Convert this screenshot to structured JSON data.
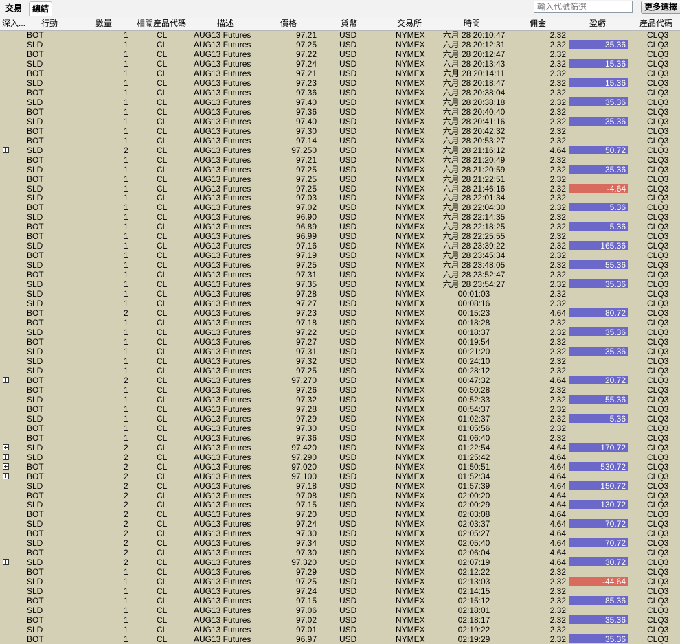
{
  "tabs": {
    "trade": "交易",
    "summary": "總結"
  },
  "filter": {
    "placeholder": "輸入代號篩選"
  },
  "more_button": "更多選擇",
  "columns": [
    "深入...",
    "行動",
    "數量",
    "相關產品代碼",
    "描述",
    "價格",
    "貨幣",
    "交易所",
    "時間",
    "佣金",
    "盈虧",
    "產品代碼"
  ],
  "colors": {
    "profit": "#6b68c9",
    "loss": "#d96b5e",
    "background": "#d4d0b5"
  },
  "rows": [
    {
      "e": 0,
      "a": "BOT",
      "q": "1",
      "u": "CL",
      "d": "AUG13 Futures",
      "p": "97.21",
      "cur": "USD",
      "x": "NYMEX",
      "t": "六月 28 20:10:47",
      "f": "2.32",
      "l": "",
      "k": "",
      "s": "CLQ3"
    },
    {
      "e": 0,
      "a": "SLD",
      "q": "1",
      "u": "CL",
      "d": "AUG13 Futures",
      "p": "97.25",
      "cur": "USD",
      "x": "NYMEX",
      "t": "六月 28 20:12:31",
      "f": "2.32",
      "l": "35.36",
      "k": "pos",
      "s": "CLQ3"
    },
    {
      "e": 0,
      "a": "BOT",
      "q": "1",
      "u": "CL",
      "d": "AUG13 Futures",
      "p": "97.22",
      "cur": "USD",
      "x": "NYMEX",
      "t": "六月 28 20:12:47",
      "f": "2.32",
      "l": "",
      "k": "",
      "s": "CLQ3"
    },
    {
      "e": 0,
      "a": "SLD",
      "q": "1",
      "u": "CL",
      "d": "AUG13 Futures",
      "p": "97.24",
      "cur": "USD",
      "x": "NYMEX",
      "t": "六月 28 20:13:43",
      "f": "2.32",
      "l": "15.36",
      "k": "pos",
      "s": "CLQ3"
    },
    {
      "e": 0,
      "a": "BOT",
      "q": "1",
      "u": "CL",
      "d": "AUG13 Futures",
      "p": "97.21",
      "cur": "USD",
      "x": "NYMEX",
      "t": "六月 28 20:14:11",
      "f": "2.32",
      "l": "",
      "k": "",
      "s": "CLQ3"
    },
    {
      "e": 0,
      "a": "SLD",
      "q": "1",
      "u": "CL",
      "d": "AUG13 Futures",
      "p": "97.23",
      "cur": "USD",
      "x": "NYMEX",
      "t": "六月 28 20:18:47",
      "f": "2.32",
      "l": "15.36",
      "k": "pos",
      "s": "CLQ3"
    },
    {
      "e": 0,
      "a": "BOT",
      "q": "1",
      "u": "CL",
      "d": "AUG13 Futures",
      "p": "97.36",
      "cur": "USD",
      "x": "NYMEX",
      "t": "六月 28 20:38:04",
      "f": "2.32",
      "l": "",
      "k": "",
      "s": "CLQ3"
    },
    {
      "e": 0,
      "a": "SLD",
      "q": "1",
      "u": "CL",
      "d": "AUG13 Futures",
      "p": "97.40",
      "cur": "USD",
      "x": "NYMEX",
      "t": "六月 28 20:38:18",
      "f": "2.32",
      "l": "35.36",
      "k": "pos",
      "s": "CLQ3"
    },
    {
      "e": 0,
      "a": "BOT",
      "q": "1",
      "u": "CL",
      "d": "AUG13 Futures",
      "p": "97.36",
      "cur": "USD",
      "x": "NYMEX",
      "t": "六月 28 20:40:40",
      "f": "2.32",
      "l": "",
      "k": "",
      "s": "CLQ3"
    },
    {
      "e": 0,
      "a": "SLD",
      "q": "1",
      "u": "CL",
      "d": "AUG13 Futures",
      "p": "97.40",
      "cur": "USD",
      "x": "NYMEX",
      "t": "六月 28 20:41:16",
      "f": "2.32",
      "l": "35.36",
      "k": "pos",
      "s": "CLQ3"
    },
    {
      "e": 0,
      "a": "BOT",
      "q": "1",
      "u": "CL",
      "d": "AUG13 Futures",
      "p": "97.30",
      "cur": "USD",
      "x": "NYMEX",
      "t": "六月 28 20:42:32",
      "f": "2.32",
      "l": "",
      "k": "",
      "s": "CLQ3"
    },
    {
      "e": 0,
      "a": "BOT",
      "q": "1",
      "u": "CL",
      "d": "AUG13 Futures",
      "p": "97.14",
      "cur": "USD",
      "x": "NYMEX",
      "t": "六月 28 20:53:27",
      "f": "2.32",
      "l": "",
      "k": "",
      "s": "CLQ3"
    },
    {
      "e": 1,
      "a": "SLD",
      "q": "2",
      "u": "CL",
      "d": "AUG13 Futures",
      "p": "97.250",
      "cur": "USD",
      "x": "NYMEX",
      "t": "六月 28 21:16:12",
      "f": "4.64",
      "l": "50.72",
      "k": "pos",
      "s": "CLQ3"
    },
    {
      "e": 0,
      "a": "BOT",
      "q": "1",
      "u": "CL",
      "d": "AUG13 Futures",
      "p": "97.21",
      "cur": "USD",
      "x": "NYMEX",
      "t": "六月 28 21:20:49",
      "f": "2.32",
      "l": "",
      "k": "",
      "s": "CLQ3"
    },
    {
      "e": 0,
      "a": "SLD",
      "q": "1",
      "u": "CL",
      "d": "AUG13 Futures",
      "p": "97.25",
      "cur": "USD",
      "x": "NYMEX",
      "t": "六月 28 21:20:59",
      "f": "2.32",
      "l": "35.36",
      "k": "pos",
      "s": "CLQ3"
    },
    {
      "e": 0,
      "a": "BOT",
      "q": "1",
      "u": "CL",
      "d": "AUG13 Futures",
      "p": "97.25",
      "cur": "USD",
      "x": "NYMEX",
      "t": "六月 28 21:22:51",
      "f": "2.32",
      "l": "",
      "k": "",
      "s": "CLQ3"
    },
    {
      "e": 0,
      "a": "SLD",
      "q": "1",
      "u": "CL",
      "d": "AUG13 Futures",
      "p": "97.25",
      "cur": "USD",
      "x": "NYMEX",
      "t": "六月 28 21:46:16",
      "f": "2.32",
      "l": "-4.64",
      "k": "neg",
      "s": "CLQ3"
    },
    {
      "e": 0,
      "a": "SLD",
      "q": "1",
      "u": "CL",
      "d": "AUG13 Futures",
      "p": "97.03",
      "cur": "USD",
      "x": "NYMEX",
      "t": "六月 28 22:01:34",
      "f": "2.32",
      "l": "",
      "k": "",
      "s": "CLQ3"
    },
    {
      "e": 0,
      "a": "BOT",
      "q": "1",
      "u": "CL",
      "d": "AUG13 Futures",
      "p": "97.02",
      "cur": "USD",
      "x": "NYMEX",
      "t": "六月 28 22:04:30",
      "f": "2.32",
      "l": "5.36",
      "k": "pos",
      "s": "CLQ3"
    },
    {
      "e": 0,
      "a": "SLD",
      "q": "1",
      "u": "CL",
      "d": "AUG13 Futures",
      "p": "96.90",
      "cur": "USD",
      "x": "NYMEX",
      "t": "六月 28 22:14:35",
      "f": "2.32",
      "l": "",
      "k": "",
      "s": "CLQ3"
    },
    {
      "e": 0,
      "a": "BOT",
      "q": "1",
      "u": "CL",
      "d": "AUG13 Futures",
      "p": "96.89",
      "cur": "USD",
      "x": "NYMEX",
      "t": "六月 28 22:18:25",
      "f": "2.32",
      "l": "5.36",
      "k": "pos",
      "s": "CLQ3"
    },
    {
      "e": 0,
      "a": "BOT",
      "q": "1",
      "u": "CL",
      "d": "AUG13 Futures",
      "p": "96.99",
      "cur": "USD",
      "x": "NYMEX",
      "t": "六月 28 22:25:55",
      "f": "2.32",
      "l": "",
      "k": "",
      "s": "CLQ3"
    },
    {
      "e": 0,
      "a": "SLD",
      "q": "1",
      "u": "CL",
      "d": "AUG13 Futures",
      "p": "97.16",
      "cur": "USD",
      "x": "NYMEX",
      "t": "六月 28 23:39:22",
      "f": "2.32",
      "l": "165.36",
      "k": "pos",
      "s": "CLQ3"
    },
    {
      "e": 0,
      "a": "BOT",
      "q": "1",
      "u": "CL",
      "d": "AUG13 Futures",
      "p": "97.19",
      "cur": "USD",
      "x": "NYMEX",
      "t": "六月 28 23:45:34",
      "f": "2.32",
      "l": "",
      "k": "",
      "s": "CLQ3"
    },
    {
      "e": 0,
      "a": "SLD",
      "q": "1",
      "u": "CL",
      "d": "AUG13 Futures",
      "p": "97.25",
      "cur": "USD",
      "x": "NYMEX",
      "t": "六月 28 23:48:05",
      "f": "2.32",
      "l": "55.36",
      "k": "pos",
      "s": "CLQ3"
    },
    {
      "e": 0,
      "a": "BOT",
      "q": "1",
      "u": "CL",
      "d": "AUG13 Futures",
      "p": "97.31",
      "cur": "USD",
      "x": "NYMEX",
      "t": "六月 28 23:52:47",
      "f": "2.32",
      "l": "",
      "k": "",
      "s": "CLQ3"
    },
    {
      "e": 0,
      "a": "SLD",
      "q": "1",
      "u": "CL",
      "d": "AUG13 Futures",
      "p": "97.35",
      "cur": "USD",
      "x": "NYMEX",
      "t": "六月 28 23:54:27",
      "f": "2.32",
      "l": "35.36",
      "k": "pos",
      "s": "CLQ3"
    },
    {
      "e": 0,
      "a": "SLD",
      "q": "1",
      "u": "CL",
      "d": "AUG13 Futures",
      "p": "97.28",
      "cur": "USD",
      "x": "NYMEX",
      "t": "00:01:03",
      "f": "2.32",
      "l": "",
      "k": "",
      "s": "CLQ3"
    },
    {
      "e": 0,
      "a": "SLD",
      "q": "1",
      "u": "CL",
      "d": "AUG13 Futures",
      "p": "97.27",
      "cur": "USD",
      "x": "NYMEX",
      "t": "00:08:16",
      "f": "2.32",
      "l": "",
      "k": "",
      "s": "CLQ3"
    },
    {
      "e": 0,
      "a": "BOT",
      "q": "2",
      "u": "CL",
      "d": "AUG13 Futures",
      "p": "97.23",
      "cur": "USD",
      "x": "NYMEX",
      "t": "00:15:23",
      "f": "4.64",
      "l": "80.72",
      "k": "pos",
      "s": "CLQ3"
    },
    {
      "e": 0,
      "a": "BOT",
      "q": "1",
      "u": "CL",
      "d": "AUG13 Futures",
      "p": "97.18",
      "cur": "USD",
      "x": "NYMEX",
      "t": "00:18:28",
      "f": "2.32",
      "l": "",
      "k": "",
      "s": "CLQ3"
    },
    {
      "e": 0,
      "a": "SLD",
      "q": "1",
      "u": "CL",
      "d": "AUG13 Futures",
      "p": "97.22",
      "cur": "USD",
      "x": "NYMEX",
      "t": "00:18:37",
      "f": "2.32",
      "l": "35.36",
      "k": "pos",
      "s": "CLQ3"
    },
    {
      "e": 0,
      "a": "BOT",
      "q": "1",
      "u": "CL",
      "d": "AUG13 Futures",
      "p": "97.27",
      "cur": "USD",
      "x": "NYMEX",
      "t": "00:19:54",
      "f": "2.32",
      "l": "",
      "k": "",
      "s": "CLQ3"
    },
    {
      "e": 0,
      "a": "SLD",
      "q": "1",
      "u": "CL",
      "d": "AUG13 Futures",
      "p": "97.31",
      "cur": "USD",
      "x": "NYMEX",
      "t": "00:21:20",
      "f": "2.32",
      "l": "35.36",
      "k": "pos",
      "s": "CLQ3"
    },
    {
      "e": 0,
      "a": "SLD",
      "q": "1",
      "u": "CL",
      "d": "AUG13 Futures",
      "p": "97.32",
      "cur": "USD",
      "x": "NYMEX",
      "t": "00:24:10",
      "f": "2.32",
      "l": "",
      "k": "",
      "s": "CLQ3"
    },
    {
      "e": 0,
      "a": "SLD",
      "q": "1",
      "u": "CL",
      "d": "AUG13 Futures",
      "p": "97.25",
      "cur": "USD",
      "x": "NYMEX",
      "t": "00:28:12",
      "f": "2.32",
      "l": "",
      "k": "",
      "s": "CLQ3"
    },
    {
      "e": 1,
      "a": "BOT",
      "q": "2",
      "u": "CL",
      "d": "AUG13 Futures",
      "p": "97.270",
      "cur": "USD",
      "x": "NYMEX",
      "t": "00:47:32",
      "f": "4.64",
      "l": "20.72",
      "k": "pos",
      "s": "CLQ3"
    },
    {
      "e": 0,
      "a": "BOT",
      "q": "1",
      "u": "CL",
      "d": "AUG13 Futures",
      "p": "97.26",
      "cur": "USD",
      "x": "NYMEX",
      "t": "00:50:28",
      "f": "2.32",
      "l": "",
      "k": "",
      "s": "CLQ3"
    },
    {
      "e": 0,
      "a": "SLD",
      "q": "1",
      "u": "CL",
      "d": "AUG13 Futures",
      "p": "97.32",
      "cur": "USD",
      "x": "NYMEX",
      "t": "00:52:33",
      "f": "2.32",
      "l": "55.36",
      "k": "pos",
      "s": "CLQ3"
    },
    {
      "e": 0,
      "a": "BOT",
      "q": "1",
      "u": "CL",
      "d": "AUG13 Futures",
      "p": "97.28",
      "cur": "USD",
      "x": "NYMEX",
      "t": "00:54:37",
      "f": "2.32",
      "l": "",
      "k": "",
      "s": "CLQ3"
    },
    {
      "e": 0,
      "a": "SLD",
      "q": "1",
      "u": "CL",
      "d": "AUG13 Futures",
      "p": "97.29",
      "cur": "USD",
      "x": "NYMEX",
      "t": "01:02:37",
      "f": "2.32",
      "l": "5.36",
      "k": "pos",
      "s": "CLQ3"
    },
    {
      "e": 0,
      "a": "BOT",
      "q": "1",
      "u": "CL",
      "d": "AUG13 Futures",
      "p": "97.30",
      "cur": "USD",
      "x": "NYMEX",
      "t": "01:05:56",
      "f": "2.32",
      "l": "",
      "k": "",
      "s": "CLQ3"
    },
    {
      "e": 0,
      "a": "BOT",
      "q": "1",
      "u": "CL",
      "d": "AUG13 Futures",
      "p": "97.36",
      "cur": "USD",
      "x": "NYMEX",
      "t": "01:06:40",
      "f": "2.32",
      "l": "",
      "k": "",
      "s": "CLQ3"
    },
    {
      "e": 1,
      "a": "SLD",
      "q": "2",
      "u": "CL",
      "d": "AUG13 Futures",
      "p": "97.420",
      "cur": "USD",
      "x": "NYMEX",
      "t": "01:22:54",
      "f": "4.64",
      "l": "170.72",
      "k": "pos",
      "s": "CLQ3"
    },
    {
      "e": 1,
      "a": "SLD",
      "q": "2",
      "u": "CL",
      "d": "AUG13 Futures",
      "p": "97.290",
      "cur": "USD",
      "x": "NYMEX",
      "t": "01:25:42",
      "f": "4.64",
      "l": "",
      "k": "",
      "s": "CLQ3"
    },
    {
      "e": 1,
      "a": "BOT",
      "q": "2",
      "u": "CL",
      "d": "AUG13 Futures",
      "p": "97.020",
      "cur": "USD",
      "x": "NYMEX",
      "t": "01:50:51",
      "f": "4.64",
      "l": "530.72",
      "k": "pos",
      "s": "CLQ3"
    },
    {
      "e": 1,
      "a": "BOT",
      "q": "2",
      "u": "CL",
      "d": "AUG13 Futures",
      "p": "97.100",
      "cur": "USD",
      "x": "NYMEX",
      "t": "01:52:34",
      "f": "4.64",
      "l": "",
      "k": "",
      "s": "CLQ3"
    },
    {
      "e": 0,
      "a": "SLD",
      "q": "2",
      "u": "CL",
      "d": "AUG13 Futures",
      "p": "97.18",
      "cur": "USD",
      "x": "NYMEX",
      "t": "01:57:39",
      "f": "4.64",
      "l": "150.72",
      "k": "pos",
      "s": "CLQ3"
    },
    {
      "e": 0,
      "a": "BOT",
      "q": "2",
      "u": "CL",
      "d": "AUG13 Futures",
      "p": "97.08",
      "cur": "USD",
      "x": "NYMEX",
      "t": "02:00:20",
      "f": "4.64",
      "l": "",
      "k": "",
      "s": "CLQ3"
    },
    {
      "e": 0,
      "a": "SLD",
      "q": "2",
      "u": "CL",
      "d": "AUG13 Futures",
      "p": "97.15",
      "cur": "USD",
      "x": "NYMEX",
      "t": "02:00:29",
      "f": "4.64",
      "l": "130.72",
      "k": "pos",
      "s": "CLQ3"
    },
    {
      "e": 0,
      "a": "BOT",
      "q": "2",
      "u": "CL",
      "d": "AUG13 Futures",
      "p": "97.20",
      "cur": "USD",
      "x": "NYMEX",
      "t": "02:03:08",
      "f": "4.64",
      "l": "",
      "k": "",
      "s": "CLQ3"
    },
    {
      "e": 0,
      "a": "SLD",
      "q": "2",
      "u": "CL",
      "d": "AUG13 Futures",
      "p": "97.24",
      "cur": "USD",
      "x": "NYMEX",
      "t": "02:03:37",
      "f": "4.64",
      "l": "70.72",
      "k": "pos",
      "s": "CLQ3"
    },
    {
      "e": 0,
      "a": "BOT",
      "q": "2",
      "u": "CL",
      "d": "AUG13 Futures",
      "p": "97.30",
      "cur": "USD",
      "x": "NYMEX",
      "t": "02:05:27",
      "f": "4.64",
      "l": "",
      "k": "",
      "s": "CLQ3"
    },
    {
      "e": 0,
      "a": "SLD",
      "q": "2",
      "u": "CL",
      "d": "AUG13 Futures",
      "p": "97.34",
      "cur": "USD",
      "x": "NYMEX",
      "t": "02:05:40",
      "f": "4.64",
      "l": "70.72",
      "k": "pos",
      "s": "CLQ3"
    },
    {
      "e": 0,
      "a": "BOT",
      "q": "2",
      "u": "CL",
      "d": "AUG13 Futures",
      "p": "97.30",
      "cur": "USD",
      "x": "NYMEX",
      "t": "02:06:04",
      "f": "4.64",
      "l": "",
      "k": "",
      "s": "CLQ3"
    },
    {
      "e": 1,
      "a": "SLD",
      "q": "2",
      "u": "CL",
      "d": "AUG13 Futures",
      "p": "97.320",
      "cur": "USD",
      "x": "NYMEX",
      "t": "02:07:19",
      "f": "4.64",
      "l": "30.72",
      "k": "pos",
      "s": "CLQ3"
    },
    {
      "e": 0,
      "a": "BOT",
      "q": "1",
      "u": "CL",
      "d": "AUG13 Futures",
      "p": "97.29",
      "cur": "USD",
      "x": "NYMEX",
      "t": "02:12:22",
      "f": "2.32",
      "l": "",
      "k": "",
      "s": "CLQ3"
    },
    {
      "e": 0,
      "a": "SLD",
      "q": "1",
      "u": "CL",
      "d": "AUG13 Futures",
      "p": "97.25",
      "cur": "USD",
      "x": "NYMEX",
      "t": "02:13:03",
      "f": "2.32",
      "l": "-44.64",
      "k": "neg",
      "s": "CLQ3"
    },
    {
      "e": 0,
      "a": "SLD",
      "q": "1",
      "u": "CL",
      "d": "AUG13 Futures",
      "p": "97.24",
      "cur": "USD",
      "x": "NYMEX",
      "t": "02:14:15",
      "f": "2.32",
      "l": "",
      "k": "",
      "s": "CLQ3"
    },
    {
      "e": 0,
      "a": "BOT",
      "q": "1",
      "u": "CL",
      "d": "AUG13 Futures",
      "p": "97.15",
      "cur": "USD",
      "x": "NYMEX",
      "t": "02:15:12",
      "f": "2.32",
      "l": "85.36",
      "k": "pos",
      "s": "CLQ3"
    },
    {
      "e": 0,
      "a": "SLD",
      "q": "1",
      "u": "CL",
      "d": "AUG13 Futures",
      "p": "97.06",
      "cur": "USD",
      "x": "NYMEX",
      "t": "02:18:01",
      "f": "2.32",
      "l": "",
      "k": "",
      "s": "CLQ3"
    },
    {
      "e": 0,
      "a": "BOT",
      "q": "1",
      "u": "CL",
      "d": "AUG13 Futures",
      "p": "97.02",
      "cur": "USD",
      "x": "NYMEX",
      "t": "02:18:17",
      "f": "2.32",
      "l": "35.36",
      "k": "pos",
      "s": "CLQ3"
    },
    {
      "e": 0,
      "a": "SLD",
      "q": "1",
      "u": "CL",
      "d": "AUG13 Futures",
      "p": "97.01",
      "cur": "USD",
      "x": "NYMEX",
      "t": "02:19:22",
      "f": "2.32",
      "l": "",
      "k": "",
      "s": "CLQ3"
    },
    {
      "e": 0,
      "a": "BOT",
      "q": "1",
      "u": "CL",
      "d": "AUG13 Futures",
      "p": "96.97",
      "cur": "USD",
      "x": "NYMEX",
      "t": "02:19:29",
      "f": "2.32",
      "l": "35.36",
      "k": "pos",
      "s": "CLQ3"
    }
  ]
}
